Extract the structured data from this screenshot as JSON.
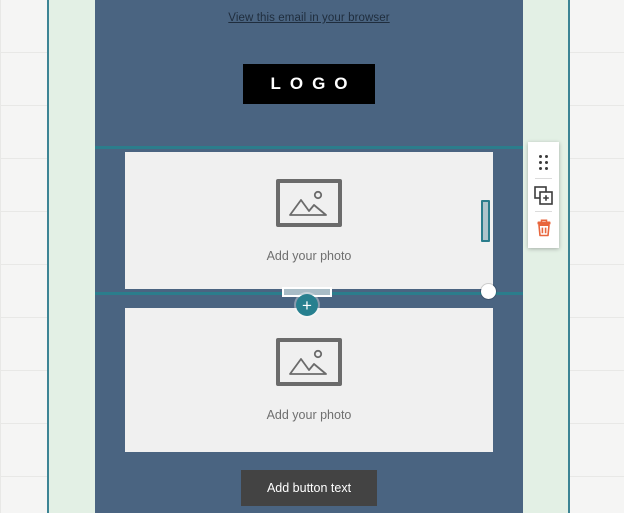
{
  "editor": {
    "name": "email-template-editor",
    "canvas_background": "#4a6481",
    "accent": "#2b7d8c",
    "gutter_color": "#e3f0e5"
  },
  "email": {
    "preheader": {
      "link_label": "View this email in your browser"
    },
    "logo": {
      "text": "LOGO",
      "background": "#000000",
      "color": "#ffffff"
    },
    "blocks": [
      {
        "type": "image",
        "placeholder_label": "Add your photo",
        "icon": "image-placeholder-icon",
        "selected": true
      },
      {
        "type": "image",
        "placeholder_label": "Add your photo",
        "icon": "image-placeholder-icon",
        "selected": false
      }
    ],
    "cta": {
      "label": "Add button text",
      "background": "#434343",
      "color": "#ffffff"
    }
  },
  "selection_toolbar": {
    "items": [
      {
        "name": "drag-handle-icon",
        "label": "Move block"
      },
      {
        "name": "duplicate-icon",
        "label": "Duplicate block"
      },
      {
        "name": "trash-icon",
        "label": "Delete block",
        "color": "#e8663d"
      }
    ]
  },
  "insert_control": {
    "name": "add-block-button",
    "glyph": "+"
  }
}
